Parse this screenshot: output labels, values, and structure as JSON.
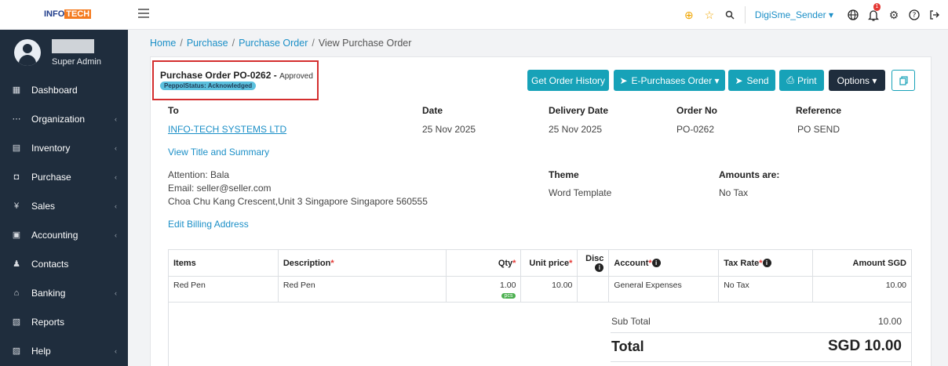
{
  "topbar": {
    "logo_part1": "INFO",
    "logo_part2": "TECH",
    "user_name": "DigiSme_Sender ▾",
    "notification_count": "1"
  },
  "sidebar": {
    "role": "Super Admin",
    "items": [
      {
        "label": "Dashboard",
        "icon": "▦",
        "chevron": ""
      },
      {
        "label": "Organization",
        "icon": "⋯",
        "chevron": "‹"
      },
      {
        "label": "Inventory",
        "icon": "▤",
        "chevron": "‹"
      },
      {
        "label": "Purchase",
        "icon": "◘",
        "chevron": "‹"
      },
      {
        "label": "Sales",
        "icon": "¥",
        "chevron": "‹"
      },
      {
        "label": "Accounting",
        "icon": "▣",
        "chevron": "‹"
      },
      {
        "label": "Contacts",
        "icon": "♟",
        "chevron": ""
      },
      {
        "label": "Banking",
        "icon": "⌂",
        "chevron": "‹"
      },
      {
        "label": "Reports",
        "icon": "▧",
        "chevron": ""
      },
      {
        "label": "Help",
        "icon": "▨",
        "chevron": "‹"
      }
    ]
  },
  "breadcrumb": {
    "home": "Home",
    "purchase": "Purchase",
    "purchase_order": "Purchase Order",
    "current": "View Purchase Order",
    "separator": "/"
  },
  "order": {
    "title": "Purchase Order PO-0262",
    "status_sep": " - ",
    "status": "Approved",
    "peppol_status": "PeppolStatus: Acknowledged"
  },
  "actions": {
    "history": "Get Order History",
    "epurchase": "E-Purchases Order ▾",
    "send": "Send",
    "print": "Print",
    "options": "Options ▾"
  },
  "details": {
    "to_label": "To",
    "to_value": "INFO-TECH SYSTEMS LTD",
    "date_label": "Date",
    "date_value": "25 Nov 2025",
    "delivery_label": "Delivery Date",
    "delivery_value": "25 Nov 2025",
    "orderno_label": "Order No",
    "orderno_value": "PO-0262",
    "reference_label": "Reference",
    "reference_value": "PO SEND",
    "view_title_link": "View Title and Summary",
    "attention": "Attention: Bala",
    "email": "Email: seller@seller.com",
    "address": "Choa Chu Kang Crescent,Unit 3 Singapore Singapore 560555",
    "edit_billing_link": "Edit Billing Address",
    "theme_label": "Theme",
    "theme_value": "Word Template",
    "amounts_label": "Amounts are:",
    "amounts_value": "No Tax"
  },
  "table": {
    "headers": {
      "items": "Items",
      "description": "Description",
      "qty": "Qty",
      "unit_price": "Unit price",
      "disc": "Disc",
      "account": "Account",
      "tax_rate": "Tax Rate",
      "amount": "Amount SGD"
    },
    "rows": [
      {
        "item": "Red Pen",
        "description": "Red Pen",
        "qty": "1.00",
        "unit": "pcs",
        "unit_price": "10.00",
        "disc": "",
        "account": "General Expenses",
        "tax_rate": "No Tax",
        "amount": "10.00"
      }
    ]
  },
  "totals": {
    "subtotal_label": "Sub Total",
    "subtotal_value": "10.00",
    "total_label": "Total",
    "total_value": "SGD 10.00"
  },
  "colors": {
    "sidebar_bg": "#1f2d3d",
    "accent_teal": "#17a2b8",
    "link_blue": "#1b8fc7",
    "highlight_red": "#d42e2e"
  }
}
